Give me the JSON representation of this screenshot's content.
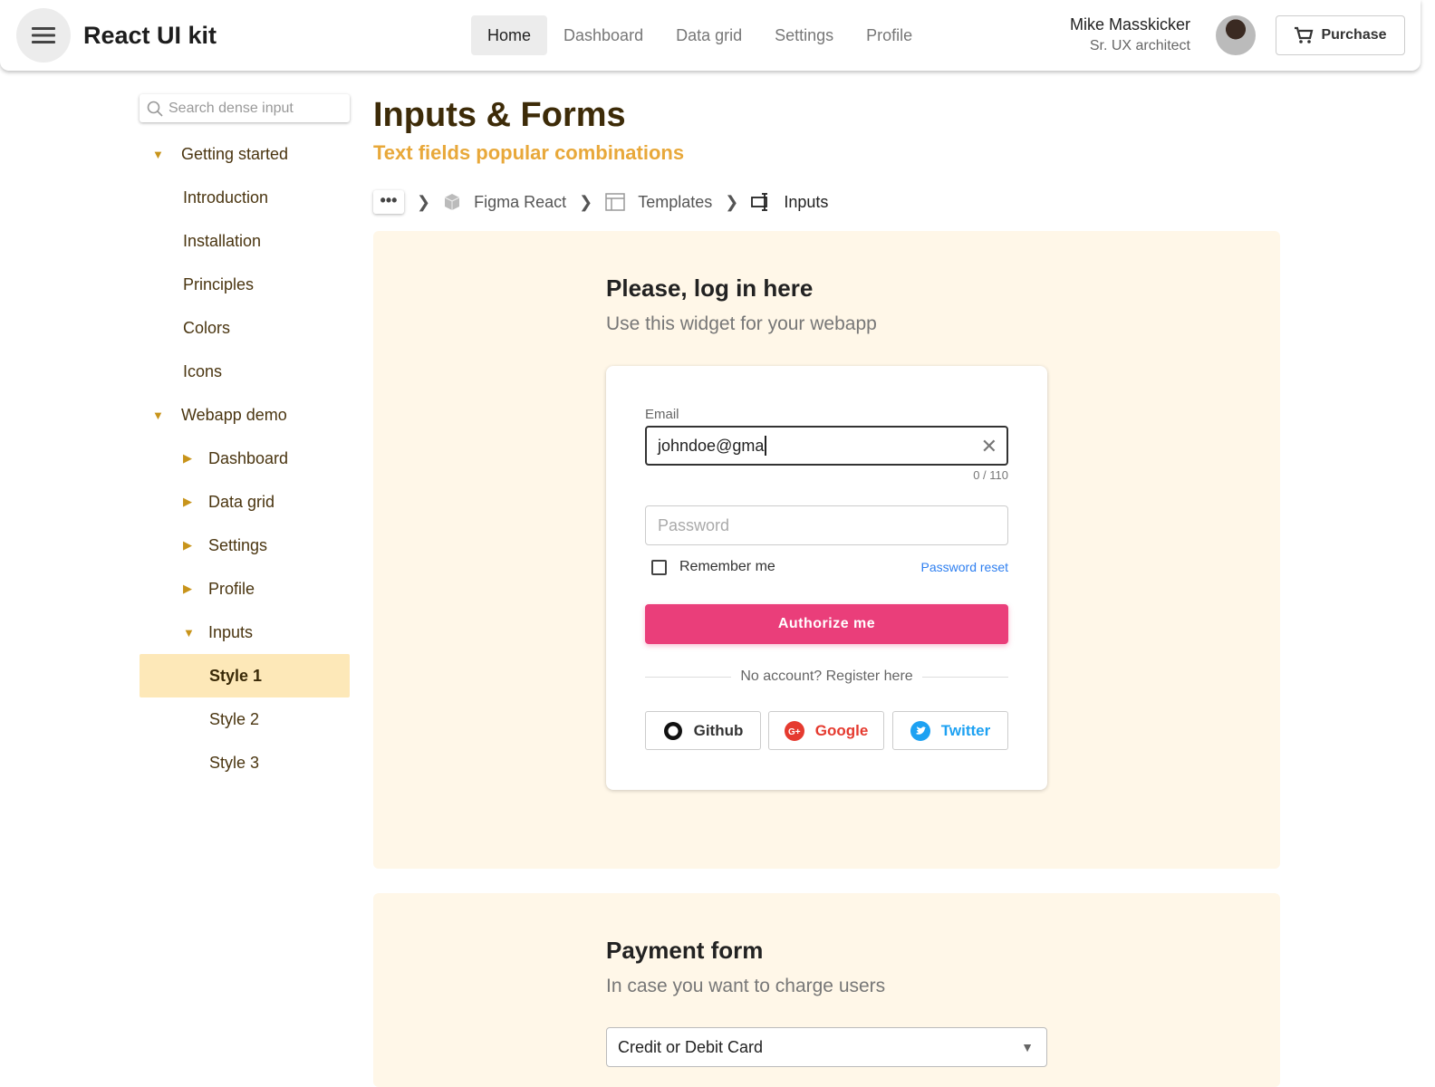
{
  "header": {
    "brand": "React UI kit",
    "nav": [
      "Home",
      "Dashboard",
      "Data grid",
      "Settings",
      "Profile"
    ],
    "user_name": "Mike Masskicker",
    "user_role": "Sr. UX architect",
    "purchase": "Purchase"
  },
  "sidebar": {
    "search_placeholder": "Search dense input",
    "items": [
      "Getting started",
      "Introduction",
      "Installation",
      "Principles",
      "Colors",
      "Icons",
      "Webapp demo",
      "Dashboard",
      "Data grid",
      "Settings",
      "Profile",
      "Inputs",
      "Style 1",
      "Style 2",
      "Style 3"
    ]
  },
  "page": {
    "title": "Inputs & Forms",
    "subtitle": "Text fields popular combinations",
    "breadcrumb": [
      "Figma React",
      "Templates",
      "Inputs"
    ],
    "breadcrumb_more": "•••"
  },
  "login": {
    "title": "Please, log in here",
    "desc": "Use this widget for your webapp",
    "email_label": "Email",
    "email_value": "johndoe@gma",
    "counter": "0 / 110",
    "password_placeholder": "Password",
    "remember": "Remember me",
    "reset": "Password reset",
    "submit": "Authorize me",
    "register": "No account? Register here",
    "social": [
      "Github",
      "Google",
      "Twitter"
    ]
  },
  "payment": {
    "title": "Payment form",
    "desc": "In case you want to charge users",
    "method": "Credit or Debit Card"
  },
  "colors": {
    "accent": "#ea3e7a",
    "gold": "#e8a83a",
    "panel": "#fff7e8"
  }
}
